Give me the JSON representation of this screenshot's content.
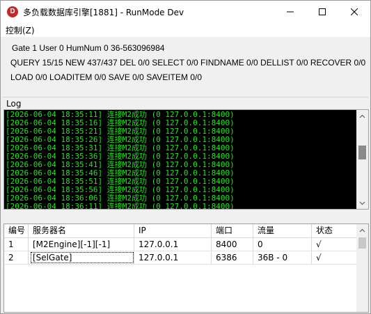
{
  "window": {
    "title": "多负载数据库引擎[1881] - RunMode Dev",
    "icon_letter": "D",
    "accent_color": "#c62828"
  },
  "menu": {
    "items": [
      {
        "label": "控制(Z)"
      }
    ]
  },
  "info": {
    "line1": "Gate 1 User 0 HumNum 0 36-563096984",
    "line2": "QUERY 15/15 NEW 437/437 DEL 0/0 SELECT 0/0 FINDNAME 0/0 DELLIST 0/0 RECOVER 0/0",
    "line3": "LOAD 0/0 LOADITEM 0/0 SAVE 0/0 SAVEITEM 0/0"
  },
  "log": {
    "label": "Log",
    "text_color": "#1ee81e",
    "lines": [
      "[2026-06-04 18:35:11] 连接M2成功 (0 127.0.0.1:8400)",
      "[2026-06-04 18:35:16] 连接M2成功 (0 127.0.0.1:8400)",
      "[2026-06-04 18:35:21] 连接M2成功 (0 127.0.0.1:8400)",
      "[2026-06-04 18:35:26] 连接M2成功 (0 127.0.0.1:8400)",
      "[2026-06-04 18:35:31] 连接M2成功 (0 127.0.0.1:8400)",
      "[2026-06-04 18:35:36] 连接M2成功 (0 127.0.0.1:8400)",
      "[2026-06-04 18:35:41] 连接M2成功 (0 127.0.0.1:8400)",
      "[2026-06-04 18:35:46] 连接M2成功 (0 127.0.0.1:8400)",
      "[2026-06-04 18:35:51] 连接M2成功 (0 127.0.0.1:8400)",
      "[2026-06-04 18:35:56] 连接M2成功 (0 127.0.0.1:8400)",
      "[2026-06-04 18:36:06] 连接M2成功 (0 127.0.0.1:8400)",
      "[2026-06-04 18:36:11] 连接M2成功 (0 127.0.0.1:8400)"
    ]
  },
  "grid": {
    "headers": [
      "编号",
      "服务器名",
      "IP",
      "端口",
      "流量",
      "状态"
    ],
    "rows": [
      [
        "1",
        "[M2Engine][-1][-1]",
        "127.0.0.1",
        "8400",
        "0",
        "√"
      ],
      [
        "2",
        "[SelGate]",
        "127.0.0.1",
        "6386",
        "36B - 0",
        "√"
      ]
    ]
  }
}
